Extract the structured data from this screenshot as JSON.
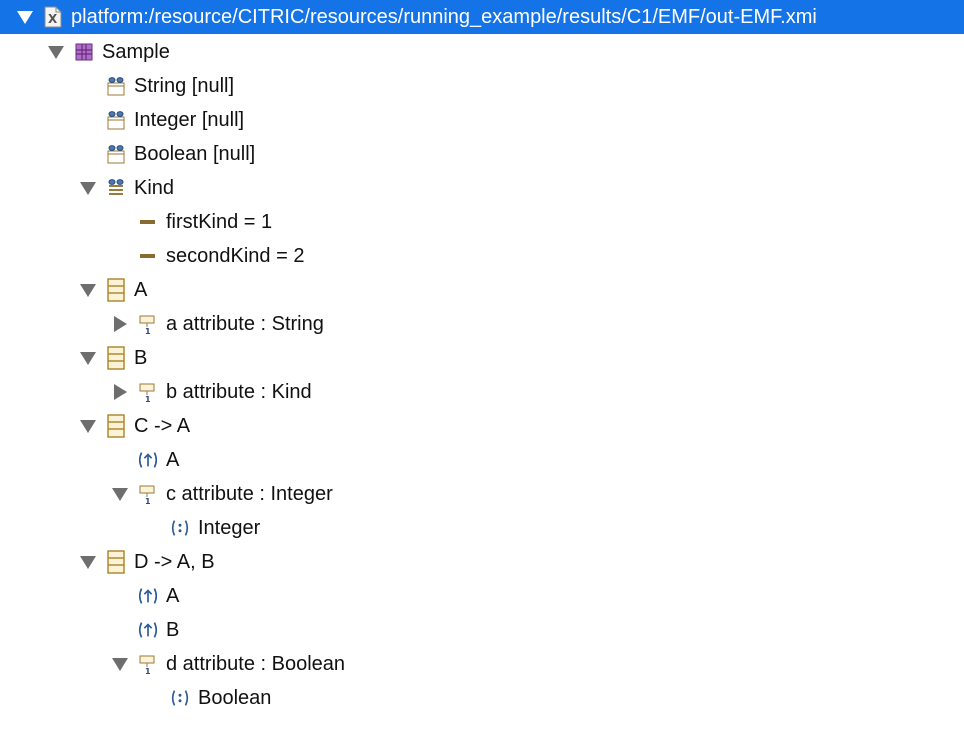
{
  "tree": {
    "root": {
      "label": "platform:/resource/CITRIC/resources/running_example/results/C1/EMF/out-EMF.xmi",
      "icon": "xmi-file-icon",
      "expanded": true,
      "selected": true
    },
    "package": {
      "label": "Sample",
      "icon": "package-icon",
      "expanded": true
    },
    "datatype_string": {
      "label": "String [null]",
      "icon": "datatype-icon"
    },
    "datatype_integer": {
      "label": "Integer [null]",
      "icon": "datatype-icon"
    },
    "datatype_boolean": {
      "label": "Boolean [null]",
      "icon": "datatype-icon"
    },
    "enum_kind": {
      "label": "Kind",
      "icon": "enum-icon",
      "expanded": true
    },
    "literal_first": {
      "label": "firstKind = 1",
      "icon": "enum-literal-icon"
    },
    "literal_second": {
      "label": "secondKind = 2",
      "icon": "enum-literal-icon"
    },
    "class_a": {
      "label": "A",
      "icon": "class-icon",
      "expanded": true
    },
    "attr_a": {
      "label": "a attribute : String",
      "icon": "attribute-icon",
      "expanded": false
    },
    "class_b": {
      "label": "B",
      "icon": "class-icon",
      "expanded": true
    },
    "attr_b": {
      "label": "b attribute : Kind",
      "icon": "attribute-icon",
      "expanded": false
    },
    "class_c": {
      "label": "C -> A",
      "icon": "class-icon",
      "expanded": true
    },
    "super_c_a": {
      "label": "A",
      "icon": "supertype-icon"
    },
    "attr_c": {
      "label": "c attribute : Integer",
      "icon": "attribute-icon",
      "expanded": true
    },
    "type_c": {
      "label": "Integer",
      "icon": "type-ref-icon"
    },
    "class_d": {
      "label": "D -> A, B",
      "icon": "class-icon",
      "expanded": true
    },
    "super_d_a": {
      "label": "A",
      "icon": "supertype-icon"
    },
    "super_d_b": {
      "label": "B",
      "icon": "supertype-icon"
    },
    "attr_d": {
      "label": "d attribute : Boolean",
      "icon": "attribute-icon",
      "expanded": true
    },
    "type_d": {
      "label": "Boolean",
      "icon": "type-ref-icon"
    }
  },
  "colors": {
    "selection": "#1473e6",
    "class_icon": "#c9a23a",
    "package_icon": "#8a3fa0",
    "supertype_icon": "#2a5a9a"
  }
}
